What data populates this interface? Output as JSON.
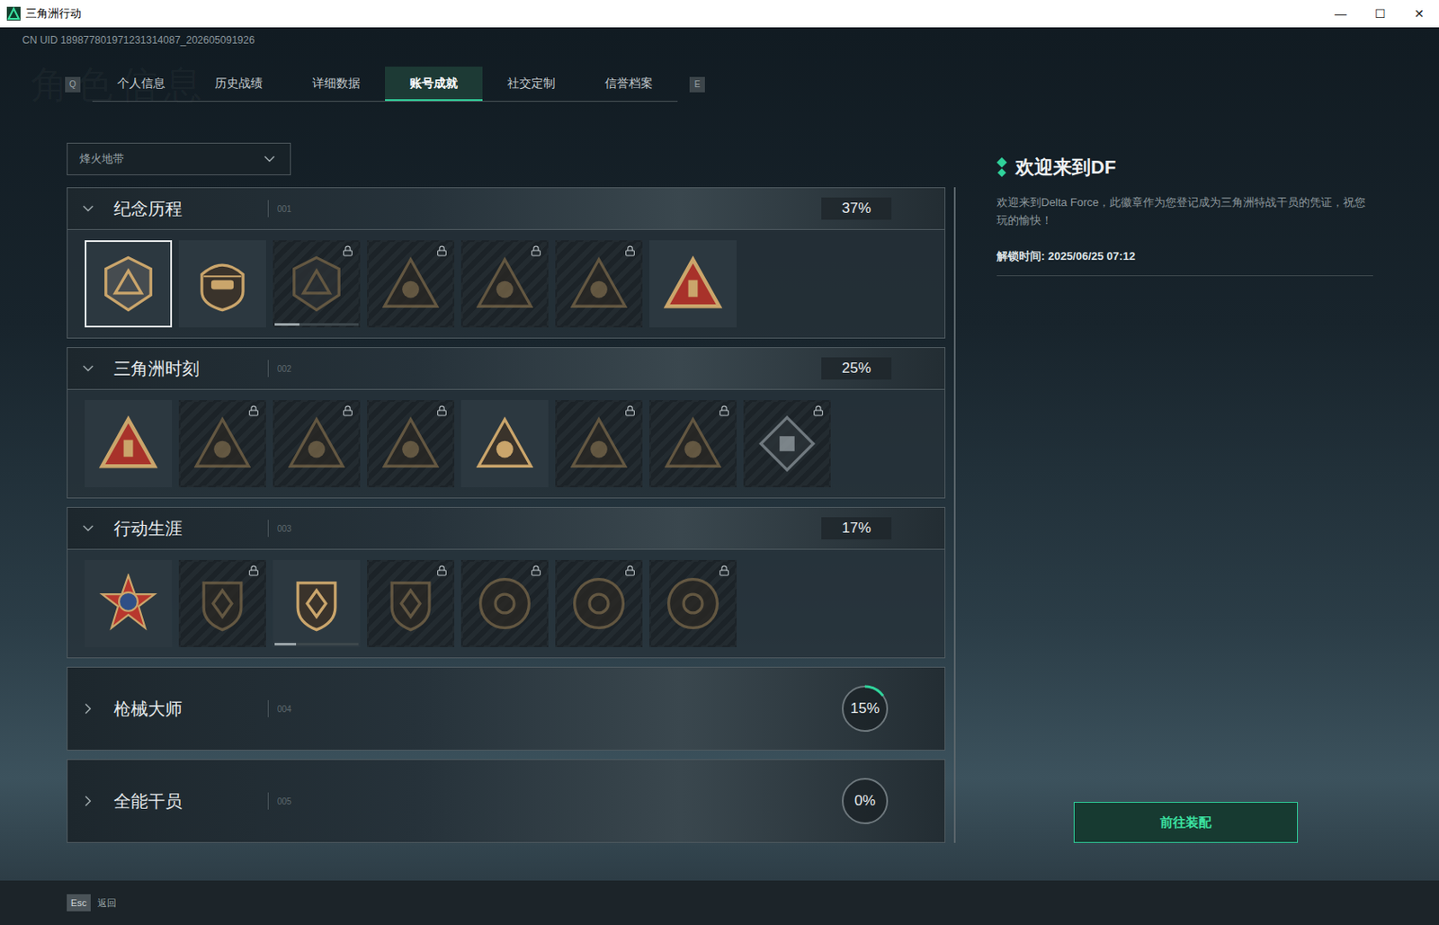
{
  "window": {
    "title": "三角洲行动",
    "controls": [
      "—",
      "☐",
      "✕"
    ]
  },
  "uid": "CN UID 189877801971231314087_202605091926",
  "watermark": "角色信息",
  "tabs": {
    "prev_key": "Q",
    "next_key": "E",
    "items": [
      {
        "label": "个人信息",
        "selected": false
      },
      {
        "label": "历史战绩",
        "selected": false
      },
      {
        "label": "详细数据",
        "selected": false
      },
      {
        "label": "账号成就",
        "selected": true
      },
      {
        "label": "社交定制",
        "selected": false
      },
      {
        "label": "信誉档案",
        "selected": false
      }
    ]
  },
  "mode_select": {
    "value": "烽火地带"
  },
  "sections": [
    {
      "title": "纪念历程",
      "code": "001",
      "percent": "37%",
      "expanded": true,
      "badges": [
        {
          "kind": "hex-shield",
          "locked": false,
          "selected": true
        },
        {
          "kind": "crest",
          "locked": false,
          "selected": false
        },
        {
          "kind": "hex-shield",
          "locked": true,
          "selected": false,
          "level": 0.3
        },
        {
          "kind": "triangle",
          "locked": true,
          "selected": false
        },
        {
          "kind": "triangle",
          "locked": true,
          "selected": false
        },
        {
          "kind": "triangle",
          "locked": true,
          "selected": false
        },
        {
          "kind": "red-triangle",
          "locked": false,
          "selected": false
        }
      ]
    },
    {
      "title": "三角洲时刻",
      "code": "002",
      "percent": "25%",
      "expanded": true,
      "badges": [
        {
          "kind": "red-triangle",
          "locked": false,
          "selected": false
        },
        {
          "kind": "triangle",
          "locked": true,
          "selected": false
        },
        {
          "kind": "triangle",
          "locked": true,
          "selected": false
        },
        {
          "kind": "triangle",
          "locked": true,
          "selected": false
        },
        {
          "kind": "triangle",
          "locked": false,
          "selected": false
        },
        {
          "kind": "triangle",
          "locked": true,
          "selected": false
        },
        {
          "kind": "triangle",
          "locked": true,
          "selected": false
        },
        {
          "kind": "diamond",
          "locked": true,
          "selected": false
        }
      ]
    },
    {
      "title": "行动生涯",
      "code": "003",
      "percent": "17%",
      "expanded": true,
      "badges": [
        {
          "kind": "medal",
          "locked": false,
          "selected": false
        },
        {
          "kind": "shield",
          "locked": true,
          "selected": false
        },
        {
          "kind": "shield",
          "locked": false,
          "selected": false,
          "level": 0.25
        },
        {
          "kind": "shield",
          "locked": true,
          "selected": false
        },
        {
          "kind": "circle",
          "locked": true,
          "selected": false
        },
        {
          "kind": "circle",
          "locked": true,
          "selected": false
        },
        {
          "kind": "circle",
          "locked": true,
          "selected": false
        }
      ]
    },
    {
      "title": "枪械大师",
      "code": "004",
      "percent": "15%",
      "expanded": false,
      "level": 0.15,
      "badges": []
    },
    {
      "title": "全能干员",
      "code": "005",
      "percent": "0%",
      "expanded": false,
      "level": 0,
      "badges": []
    }
  ],
  "detail": {
    "title": "欢迎来到DF",
    "description": "欢迎来到Delta Force，此徽章作为您登记成为三角洲特战干员的凭证，祝您玩的愉快！",
    "unlock_time": "解锁时间: 2025/06/25 07:12",
    "button": "前往装配"
  },
  "footer": {
    "key": "Esc",
    "label": "返回"
  }
}
